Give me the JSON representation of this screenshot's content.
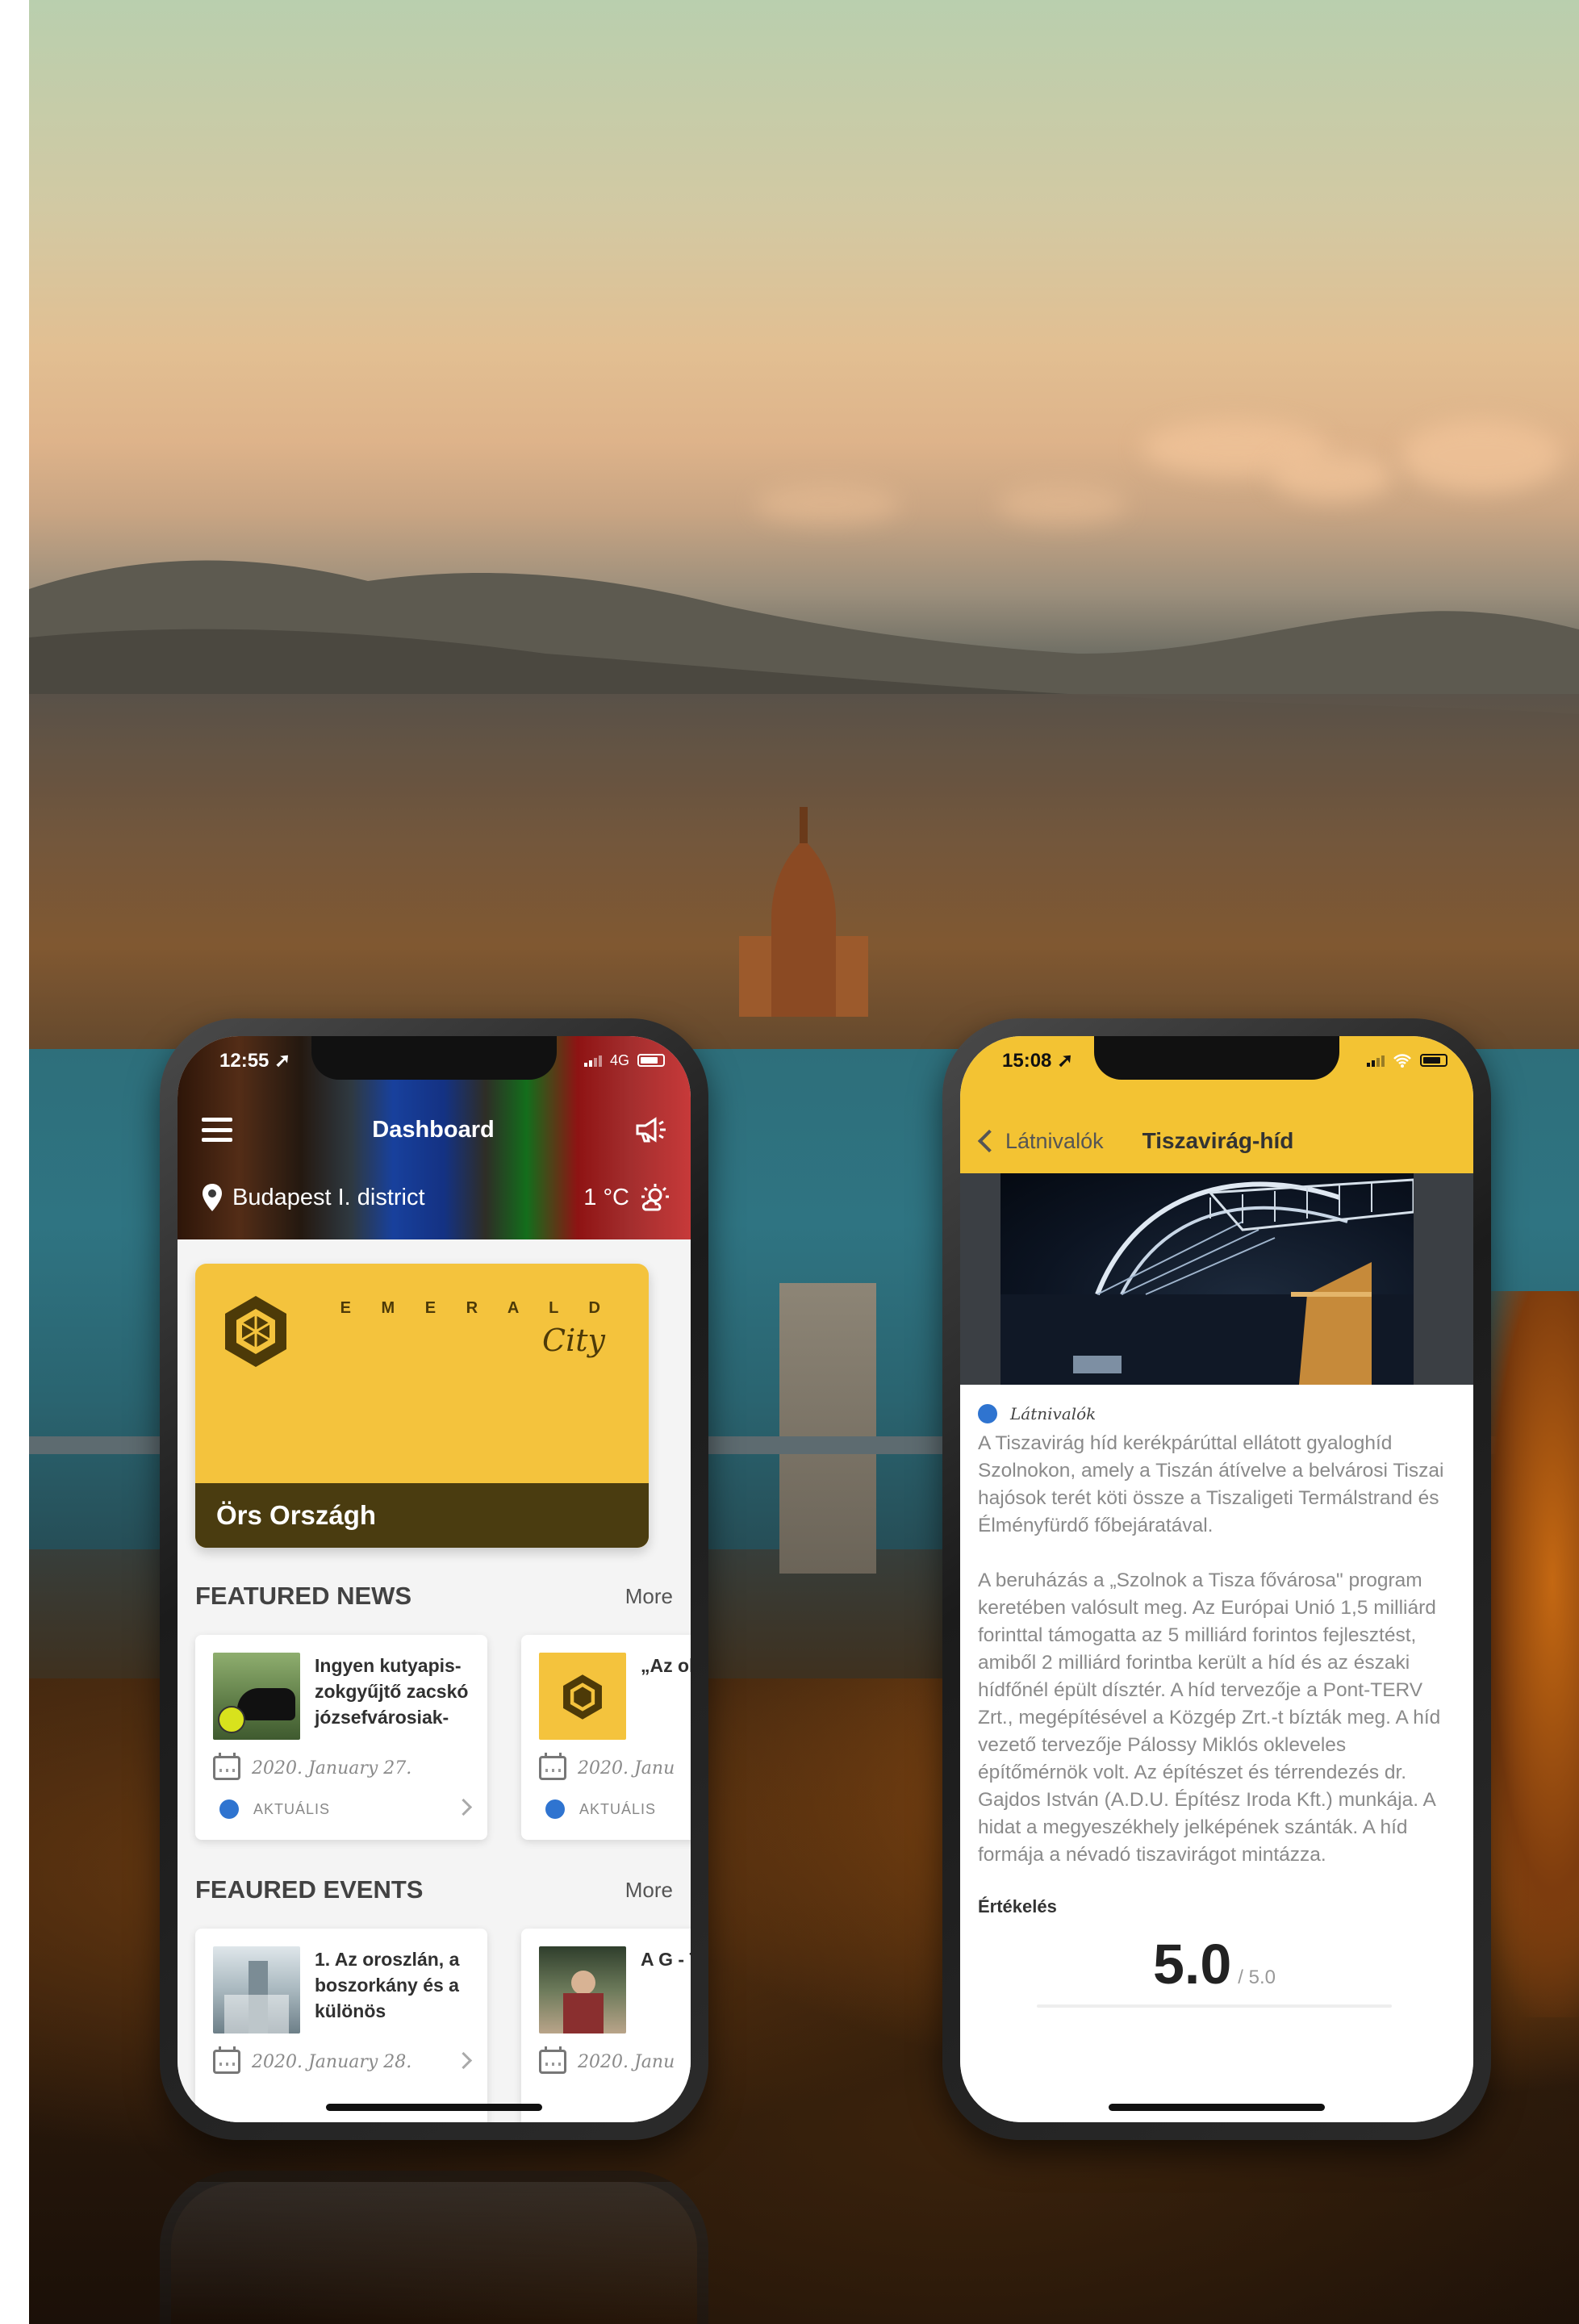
{
  "left_phone": {
    "status": {
      "time": "12:55",
      "network": "4G"
    },
    "header": {
      "title": "Dashboard",
      "location": "Budapest I. district",
      "temperature": "1 °C"
    },
    "card": {
      "brand_word": "E M E R A L D",
      "brand_script": "City",
      "holder_name": "Örs Országh"
    },
    "featured_news": {
      "title": "FEATURED NEWS",
      "more_label": "More",
      "items": [
        {
          "title": "Ingyen kutyapis-zokgyűjtő zacskó józsefvárosiak-",
          "date": "2020. January 27.",
          "tag": "AKTUÁLIS"
        },
        {
          "title": "„Az old der",
          "date": "2020. Janu",
          "tag": "AKTUÁLIS"
        }
      ]
    },
    "featured_events": {
      "title": "FEAURED EVENTS",
      "more_label": "More",
      "items": [
        {
          "title": "1. Az oroszlán, a boszorkány és a különös",
          "date": "2020. January 28."
        },
        {
          "title": "A G - TE",
          "date": "2020. Janu"
        }
      ]
    }
  },
  "right_phone": {
    "status": {
      "time": "15:08"
    },
    "nav": {
      "back_label": "Látnivalók",
      "title": "Tiszavirág-híd"
    },
    "category": "Látnivalók",
    "paragraphs": [
      "A Tiszavirág híd kerékpárúttal ellátott gyaloghíd Szolnokon, amely a Tiszán átívelve a belvárosi Tiszai hajósok terét köti össze a Tiszaligeti Termálstrand és Élményfürdő főbejáratával.",
      "A beruházás a „Szolnok a Tisza fővárosa\" program keretében valósult meg. Az Európai Unió 1,5 milliárd forinttal támogatta az 5 milliárd forintos fejlesztést, amiből 2 milliárd forintba került a híd és az északi hídfőnél épült dísztér. A híd tervezője a Pont-TERV Zrt., megépítésével a Közgép Zrt.-t bízták meg. A híd vezető tervezője Pálossy Miklós okleveles építőmérnök volt. Az építészet és térrendezés dr. Gajdos István (A.D.U. Építész Iroda Kft.) munkája. A hidat a megyeszékhely jelképének szánták. A híd formája a névadó tiszavirágot mintázza."
    ],
    "rating": {
      "label": "Értékelés",
      "value": "5.0",
      "max": "/ 5.0"
    }
  },
  "colors": {
    "accent_yellow": "#f3c333",
    "tag_blue": "#2f74d0",
    "card_bar": "#4a3c10"
  }
}
